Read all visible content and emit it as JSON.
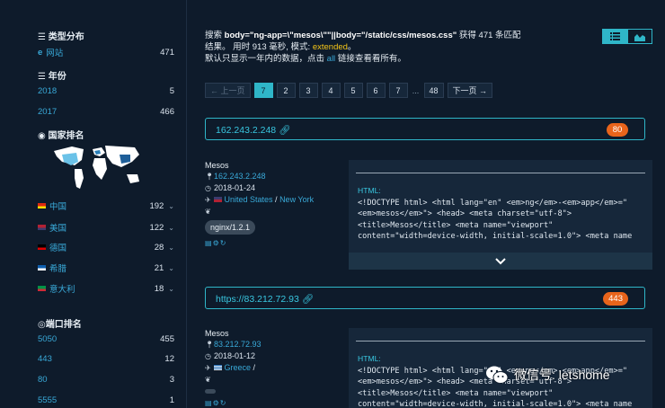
{
  "sidebar": {
    "type_section": {
      "title": "类型分布",
      "items": [
        {
          "label": "网站",
          "count": "471"
        }
      ]
    },
    "year_section": {
      "title": "年份",
      "items": [
        {
          "label": "2018",
          "count": "5"
        },
        {
          "label": "2017",
          "count": "466"
        }
      ]
    },
    "country_section": {
      "title": "国家排名",
      "items": [
        {
          "label": "中国",
          "count": "192",
          "flag_colors": [
            "#de2910",
            "#ffde00"
          ]
        },
        {
          "label": "美国",
          "count": "122",
          "flag_colors": [
            "#b22234",
            "#3c3b6e"
          ]
        },
        {
          "label": "德国",
          "count": "28",
          "flag_colors": [
            "#000000",
            "#dd0000"
          ]
        },
        {
          "label": "希腊",
          "count": "21",
          "flag_colors": [
            "#0d5eaf",
            "#ffffff"
          ]
        },
        {
          "label": "意大利",
          "count": "18",
          "flag_colors": [
            "#009246",
            "#ce2b37"
          ]
        }
      ]
    },
    "port_section": {
      "title": "端口排名",
      "items": [
        {
          "label": "5050",
          "count": "455"
        },
        {
          "label": "443",
          "count": "12"
        },
        {
          "label": "80",
          "count": "3"
        },
        {
          "label": "5555",
          "count": "1"
        }
      ]
    }
  },
  "summary": {
    "prefix": "搜索",
    "query": "body=\"ng-app=\\\"mesos\\\"\"||body=\"/static/css/mesos.css\"",
    "found": "获得 471 条匹配",
    "line2_a": "结果。 用时 913 毫秒, 模式:",
    "mode": "extended",
    "line2_b": "。",
    "line3_a": "默认只显示一年内的数据，点击",
    "all_link": "all",
    "line3_b": "链接查看看所有。"
  },
  "pagination": {
    "prev": "← 上一页",
    "pages": [
      "7",
      "2",
      "3",
      "4",
      "5",
      "6",
      "7",
      "...",
      "48"
    ],
    "current_index": 0,
    "next": "下一页 →"
  },
  "results": [
    {
      "host": "162.243.2.248",
      "badge": "80",
      "title": "Mesos",
      "ip": "162.243.2.248",
      "date": "2018-01-24",
      "country": "United States",
      "city": "New York",
      "tag": "nginx/1.2.1",
      "html_label": "HTML:",
      "html": "<!DOCTYPE html> <html lang=\"en\" <em>ng</em>-<em>app</em>=\"<em>mesos</em>\"> <head> <meta charset=\"utf-8\"> <title>Mesos</title> <meta name=\"viewport\" content=\"width=device-width, initial-scale=1.0\"> <meta name"
    },
    {
      "host": "https://83.212.72.93",
      "badge": "443",
      "title": "Mesos",
      "ip": "83.212.72.93",
      "date": "2018-01-12",
      "country": "Greece",
      "city": "",
      "tag": "",
      "html_label": "HTML:",
      "html": "<!DOCTYPE html> <html lang=\"en\" <em>ng</em>-<em>app</em>=\"<em>mesos</em>\"> <head> <meta charset=\"utf-8\"> <title>Mesos</title> <meta name=\"viewport\" content=\"width=device-width, initial-scale=1.0\"> <meta name"
    }
  ],
  "watermark": {
    "text": "微信号: letshome"
  },
  "colors": {
    "accent": "#2fb6c8",
    "link": "#39a9d8",
    "badge": "#e8641b",
    "mode": "#f5c518",
    "bg": "#0e1b2b"
  }
}
